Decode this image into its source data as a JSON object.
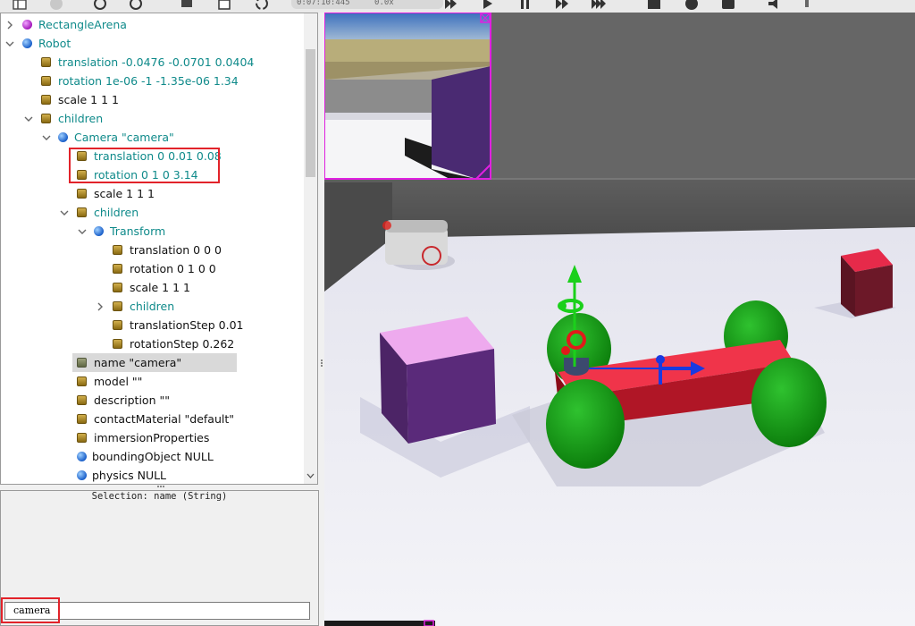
{
  "toolbar": {
    "sim_time": "0:07:10:445",
    "speed": "0.0x"
  },
  "scene_tree": {
    "rows": [
      {
        "label": "RectangleArena"
      },
      {
        "label": "Robot"
      },
      {
        "label": "translation -0.0476 -0.0701 0.0404"
      },
      {
        "label": "rotation 1e-06 -1 -1.35e-06 1.34"
      },
      {
        "label": "scale 1 1 1"
      },
      {
        "label": "children"
      },
      {
        "label": "Camera \"camera\""
      },
      {
        "label": "translation 0 0.01 0.08"
      },
      {
        "label": "rotation 0 1 0 3.14"
      },
      {
        "label": "scale 1 1 1"
      },
      {
        "label": "children"
      },
      {
        "label": "Transform"
      },
      {
        "label": "translation 0 0 0"
      },
      {
        "label": "rotation 0 1 0 0"
      },
      {
        "label": "scale 1 1 1"
      },
      {
        "label": "children"
      },
      {
        "label": "translationStep 0.01"
      },
      {
        "label": "rotationStep 0.262"
      },
      {
        "label": "name \"camera\""
      },
      {
        "label": "model \"\""
      },
      {
        "label": "description \"\""
      },
      {
        "label": "contactMaterial \"default\""
      },
      {
        "label": "immersionProperties"
      },
      {
        "label": "boundingObject NULL"
      },
      {
        "label": "physics NULL"
      }
    ]
  },
  "field_editor": {
    "selection_label": "Selection: name (String)",
    "value": "camera"
  },
  "colors": {
    "highlight": "#e2232a",
    "tree_text_teal": "#0f8a8a",
    "camera_overlay_border": "#e020e0"
  }
}
